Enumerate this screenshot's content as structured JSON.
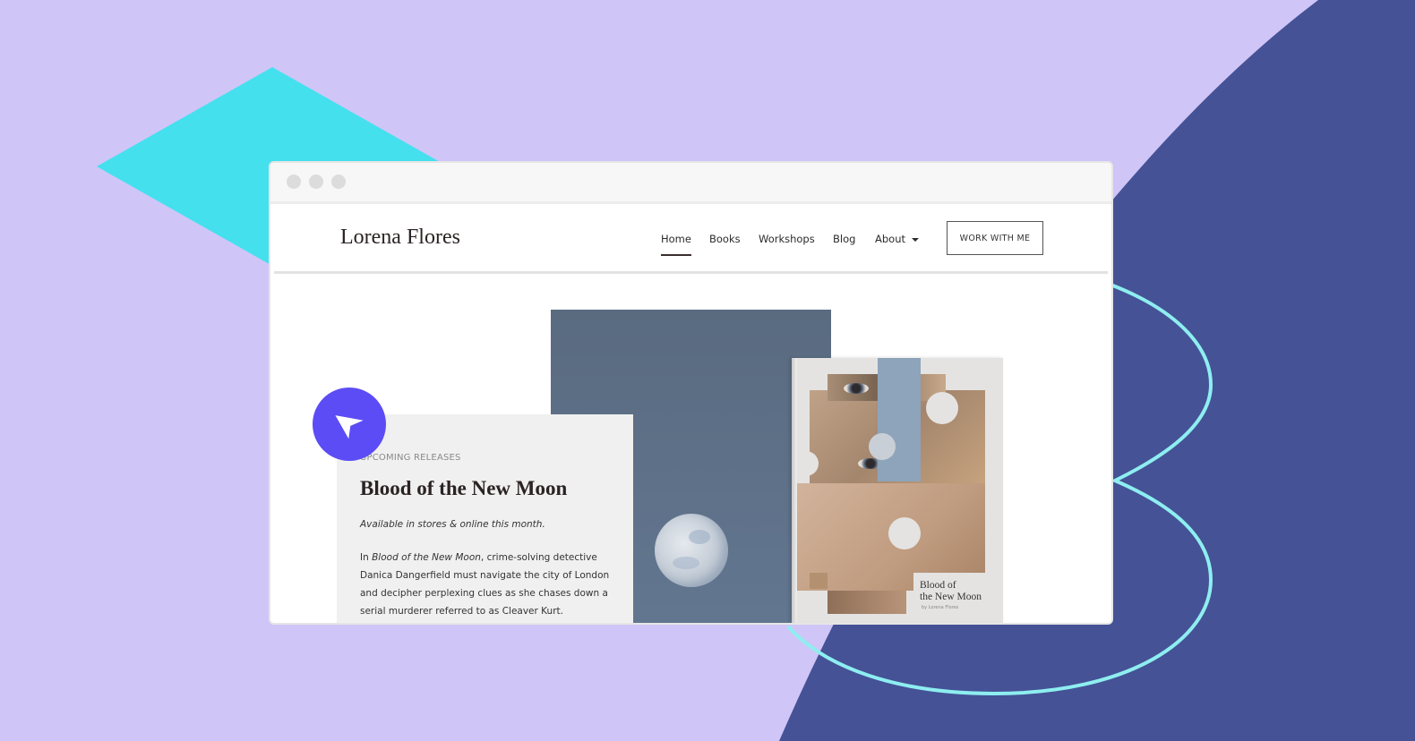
{
  "colors": {
    "background": "#d0c5f7",
    "accent_cyan": "#44e0ee",
    "navy_shape": "#455296",
    "outline_cyan": "#8eeef0",
    "cursor_badge": "#5c4cf5"
  },
  "browser": {
    "window_controls": [
      "close",
      "minimize",
      "maximize"
    ]
  },
  "site": {
    "logo": "Lorena Flores",
    "nav": [
      {
        "label": "Home",
        "active": true
      },
      {
        "label": "Books",
        "active": false
      },
      {
        "label": "Workshops",
        "active": false
      },
      {
        "label": "Blog",
        "active": false
      },
      {
        "label": "About",
        "active": false,
        "has_dropdown": true
      }
    ],
    "cta_label": "WORK WITH ME"
  },
  "feature": {
    "eyebrow": "UPCOMING RELEASES",
    "title": "Blood of the New Moon",
    "subtitle": "Available in stores & online this month.",
    "body_prefix": "In ",
    "body_italic": "Blood of the New Moon",
    "body_rest": ", crime-solving detective Danica Dangerfield must navigate the city of London and decipher perplexing clues as she chases down a serial murderer referred to as Cleaver Kurt."
  },
  "book_cover": {
    "title_line1": "Blood of",
    "title_line2": "the New Moon",
    "author": "by Lorena Flores"
  },
  "icons": {
    "cursor": "cursor-arrow-icon"
  }
}
